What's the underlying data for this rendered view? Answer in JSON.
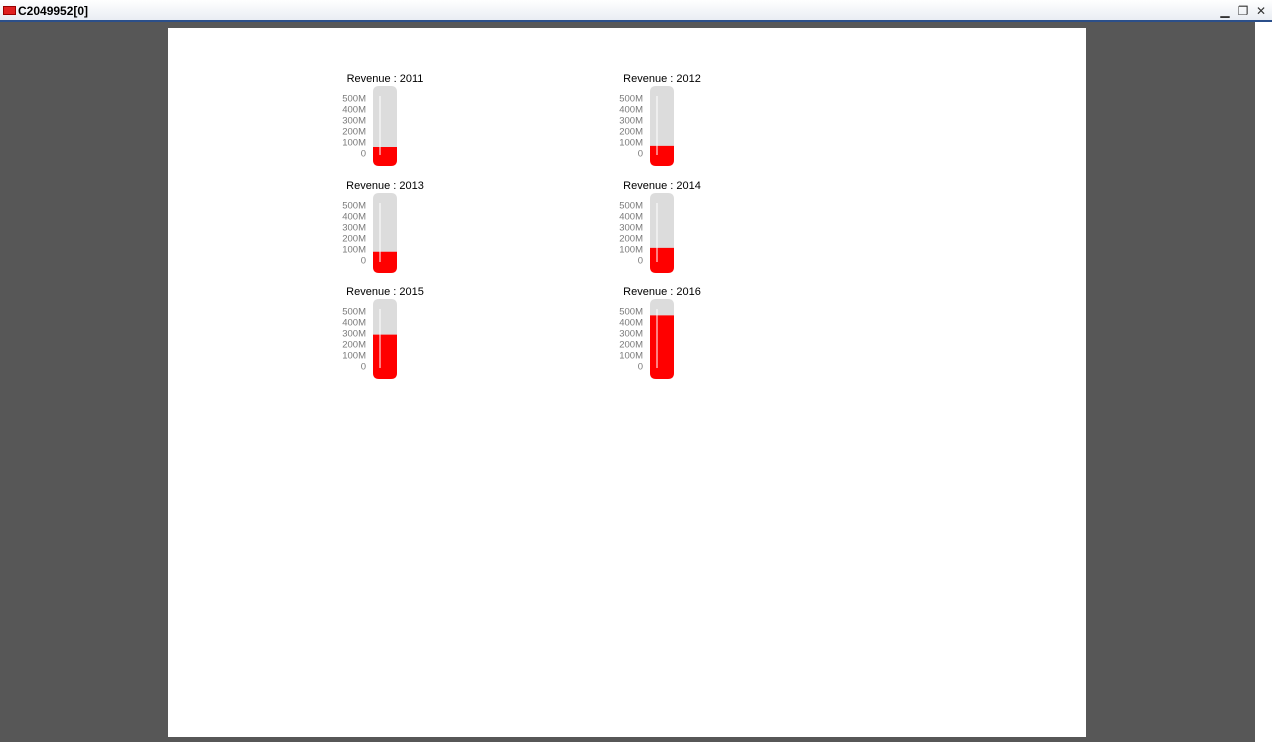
{
  "window": {
    "title": "C2049952[0]"
  },
  "colors": {
    "fill": "#ff0000",
    "track": "#dcdcdc",
    "needle": "#ffffff"
  },
  "chart_data": [
    {
      "type": "thermometer",
      "title": "Revenue : 2011",
      "value": 55,
      "unit": "M",
      "ylim": [
        0,
        500
      ],
      "ticks": [
        "500M",
        "400M",
        "300M",
        "200M",
        "100M",
        "0"
      ]
    },
    {
      "type": "thermometer",
      "title": "Revenue : 2012",
      "value": 65,
      "unit": "M",
      "ylim": [
        0,
        500
      ],
      "ticks": [
        "500M",
        "400M",
        "300M",
        "200M",
        "100M",
        "0"
      ]
    },
    {
      "type": "thermometer",
      "title": "Revenue : 2013",
      "value": 75,
      "unit": "M",
      "ylim": [
        0,
        500
      ],
      "ticks": [
        "500M",
        "400M",
        "300M",
        "200M",
        "100M",
        "0"
      ]
    },
    {
      "type": "thermometer",
      "title": "Revenue : 2014",
      "value": 110,
      "unit": "M",
      "ylim": [
        0,
        500
      ],
      "ticks": [
        "500M",
        "400M",
        "300M",
        "200M",
        "100M",
        "0"
      ]
    },
    {
      "type": "thermometer",
      "title": "Revenue : 2015",
      "value": 285,
      "unit": "M",
      "ylim": [
        0,
        500
      ],
      "ticks": [
        "500M",
        "400M",
        "300M",
        "200M",
        "100M",
        "0"
      ]
    },
    {
      "type": "thermometer",
      "title": "Revenue : 2016",
      "value": 460,
      "unit": "M",
      "ylim": [
        0,
        500
      ],
      "ticks": [
        "500M",
        "400M",
        "300M",
        "200M",
        "100M",
        "0"
      ]
    }
  ]
}
